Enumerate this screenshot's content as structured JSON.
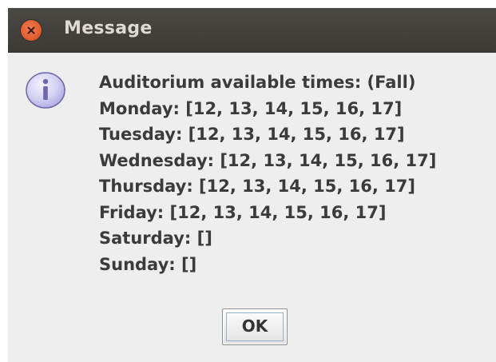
{
  "window": {
    "title": "Message"
  },
  "icon": "info-icon",
  "message": {
    "lines": [
      "Auditorium available times: (Fall)",
      "Monday: [12, 13, 14, 15, 16, 17]",
      "Tuesday: [12, 13, 14, 15, 16, 17]",
      "Wednesday: [12, 13, 14, 15, 16, 17]",
      "Thursday: [12, 13, 14, 15, 16, 17]",
      "Friday: [12, 13, 14, 15, 16, 17]",
      "Saturday: []",
      "Sunday: []"
    ]
  },
  "buttons": {
    "ok_label": "OK"
  },
  "colors": {
    "titlebar": "#3f3e3a",
    "close_button": "#e05a2b",
    "dialog_background": "#eeeeee"
  }
}
